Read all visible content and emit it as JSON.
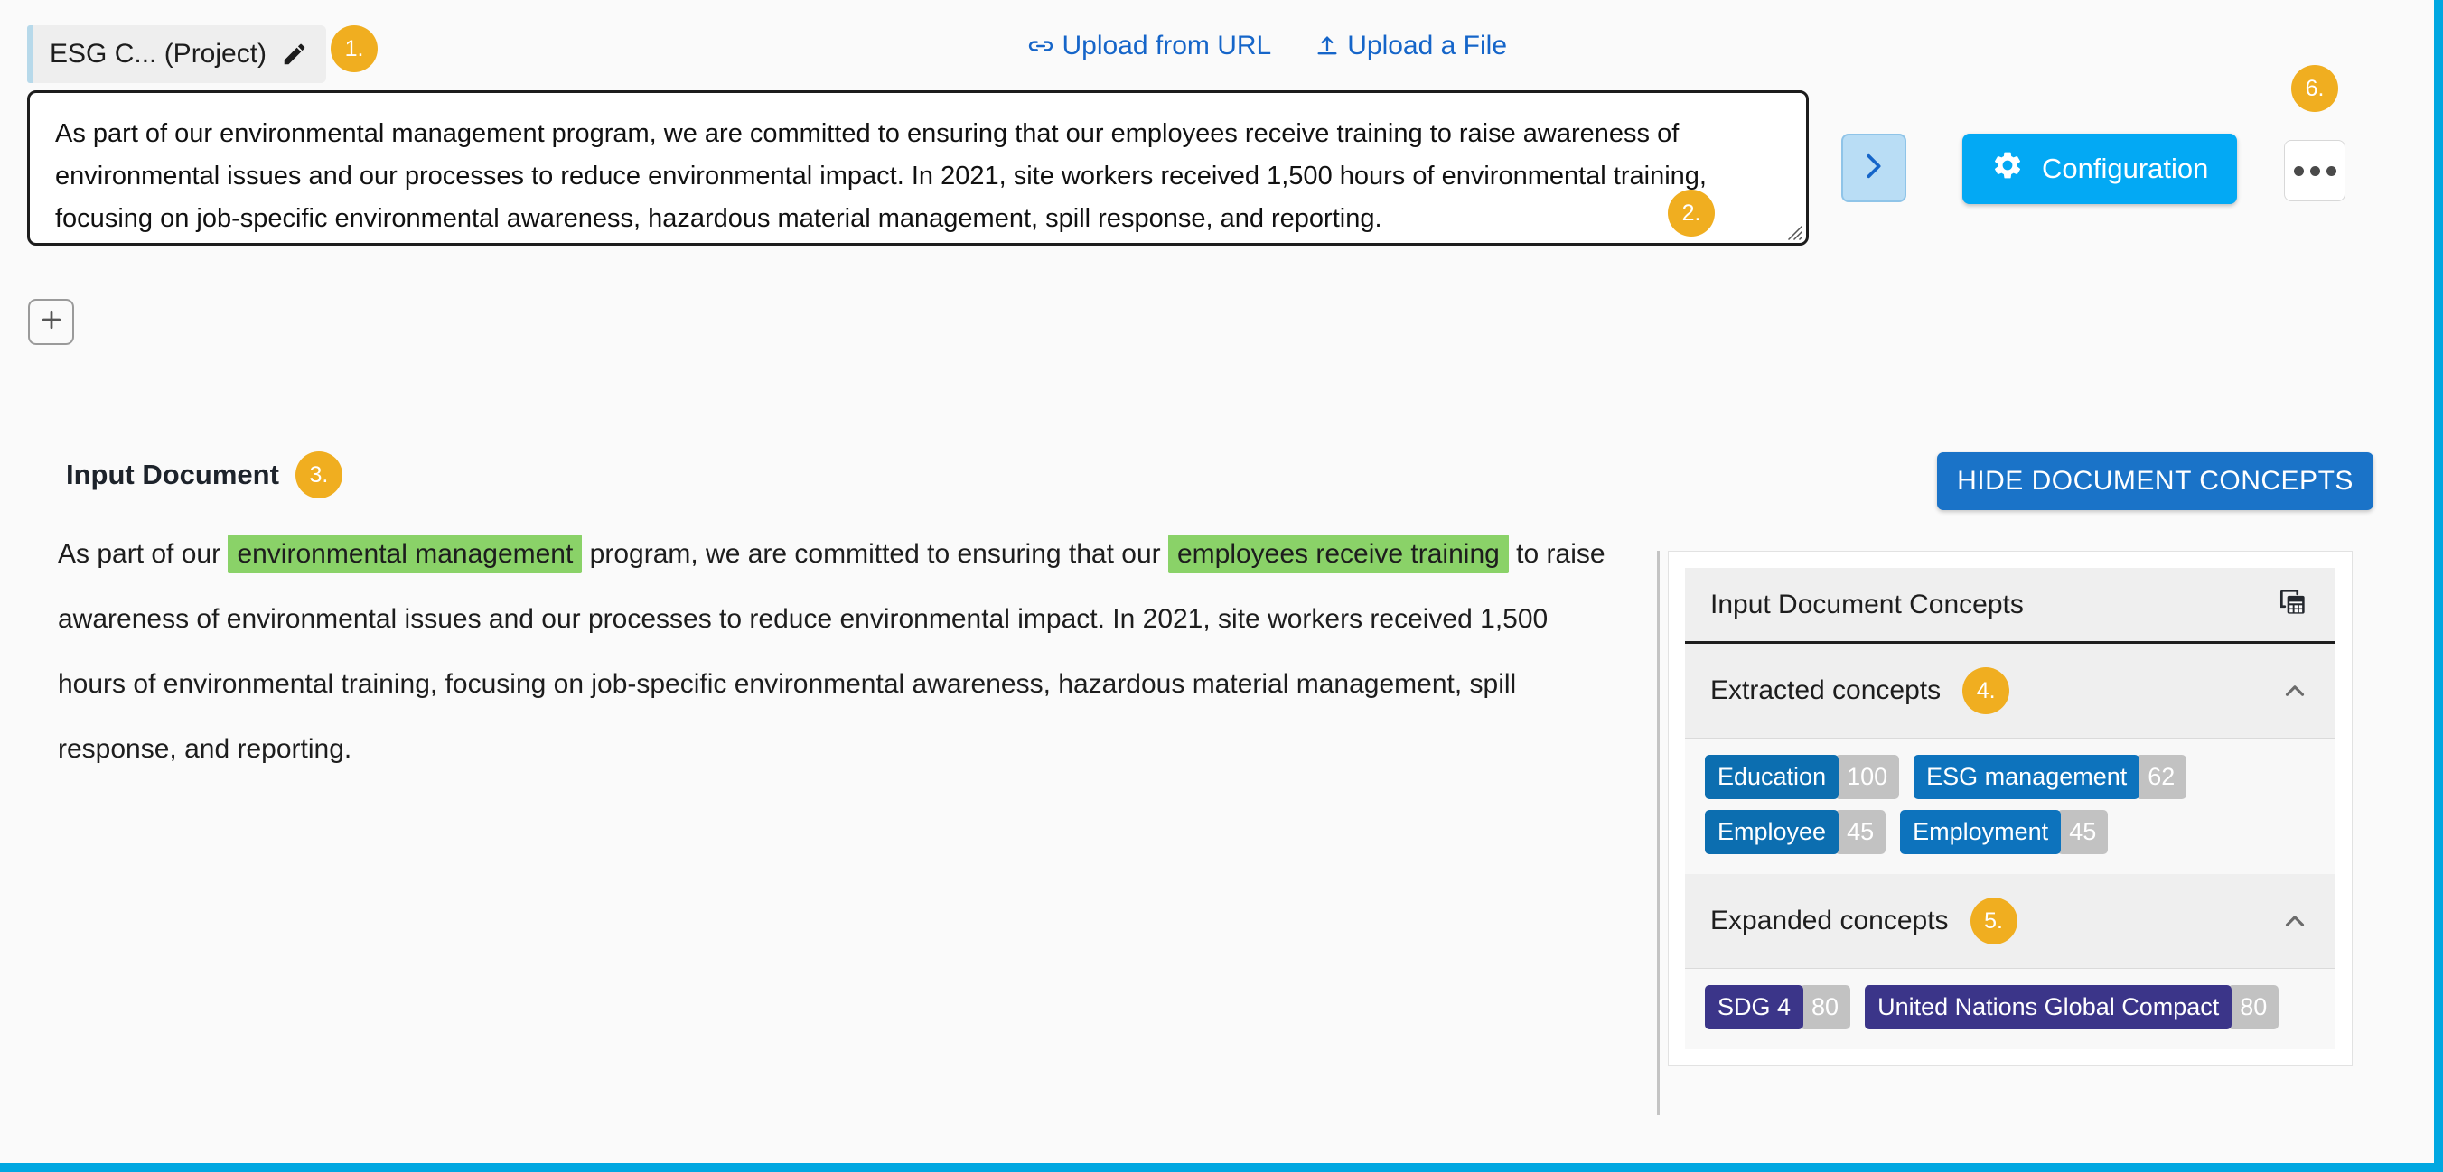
{
  "topbar": {
    "project_tab_label": "ESG C... (Project)",
    "edit_icon": "pencil-icon",
    "upload_url_label": "Upload from URL",
    "upload_url_icon": "link-icon",
    "upload_file_label": "Upload a File",
    "upload_file_icon": "upload-icon"
  },
  "editor": {
    "text": "As part of our environmental management program, we are committed to ensuring that our employees receive training to raise awareness of environmental issues and our processes to reduce environmental impact. In 2021, site workers received 1,500 hours of environmental training, focusing on job-specific environmental awareness, hazardous material management, spill response, and reporting."
  },
  "actions": {
    "run_icon": "chevron-right-icon",
    "configuration_label": "Configuration",
    "configuration_icon": "gear-icon",
    "more_icon": "ellipsis-icon",
    "add_label": "+",
    "add_icon": "plus-icon"
  },
  "section": {
    "title": "Input Document",
    "hide_button_label": "HIDE DOCUMENT CONCEPTS"
  },
  "document": {
    "segments": [
      {
        "text": "As part of our ",
        "highlight": false
      },
      {
        "text": "environmental management",
        "highlight": true
      },
      {
        "text": " program, we are committed to ensuring that our ",
        "highlight": false
      },
      {
        "text": "employees receive training",
        "highlight": true
      },
      {
        "text": " to raise awareness of environmental issues and our processes to reduce environmental impact. In 2021, site workers received 1,500 hours of environmental training, focusing on job-specific environmental awareness, hazardous material management, spill response, and reporting.",
        "highlight": false
      }
    ]
  },
  "concepts_panel": {
    "header_title": "Input Document Concepts",
    "header_icon": "table-copy-icon",
    "sections": [
      {
        "title": "Extracted concepts",
        "marker": "4.",
        "collapse_icon": "chevron-up-icon",
        "tags": [
          {
            "name": "Education",
            "score": "100",
            "color": "#0c6eb0"
          },
          {
            "name": "ESG management",
            "score": "62",
            "color": "#0d73bd"
          },
          {
            "name": "Employee",
            "score": "45",
            "color": "#0c6eb0"
          },
          {
            "name": "Employment",
            "score": "45",
            "color": "#0d73bd"
          }
        ]
      },
      {
        "title": "Expanded concepts",
        "marker": "5.",
        "collapse_icon": "chevron-up-icon",
        "tags": [
          {
            "name": "SDG 4",
            "score": "80",
            "color": "#3b3589"
          },
          {
            "name": "United Nations Global Compact",
            "score": "80",
            "color": "#3b3589"
          }
        ]
      }
    ]
  },
  "markers": {
    "m1": "1.",
    "m2": "2.",
    "m3": "3.",
    "m4": "4.",
    "m5": "5.",
    "m6": "6."
  },
  "colors": {
    "accent_cyan": "#00a7e1",
    "link_blue": "#1565c9",
    "primary_blue": "#1a73c8",
    "config_blue": "#03a9f4",
    "marker_gold": "#f0ae20",
    "highlight_green": "#8ad268",
    "score_gray": "#c2c2c2"
  }
}
